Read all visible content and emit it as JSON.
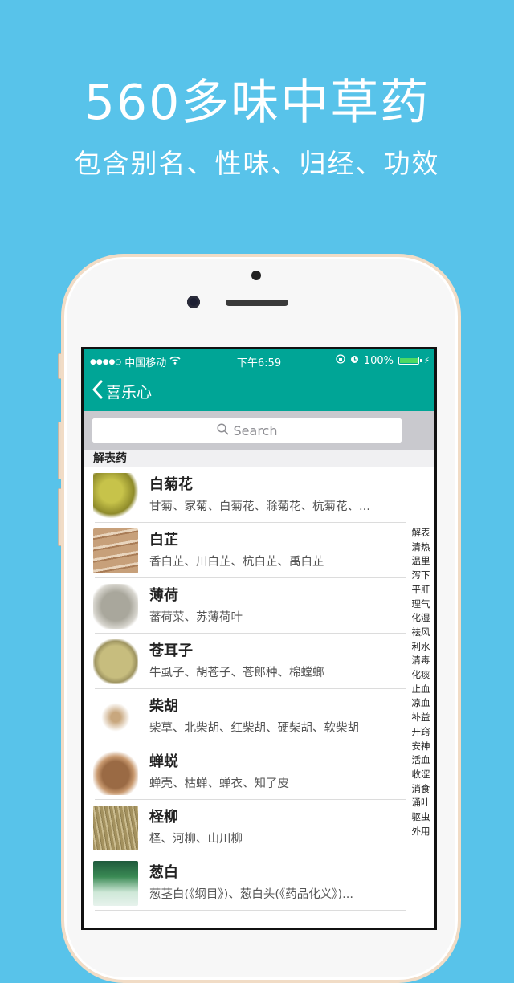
{
  "promo": {
    "headline": "560多味中草药",
    "subline": "包含别名、性味、归经、功效"
  },
  "statusbar": {
    "signal": "●●●●○",
    "carrier": "中国移动",
    "wifi_icon": "wifi-icon",
    "time": "下午6:59",
    "battery_percent": "100%",
    "battery_level": 1.0
  },
  "navbar": {
    "back_label": "喜乐心"
  },
  "search": {
    "placeholder": "Search"
  },
  "section": {
    "title": "解表药"
  },
  "items": [
    {
      "name": "白菊花",
      "alias": "甘菊、家菊、白菊花、滁菊花、杭菊花、..."
    },
    {
      "name": "白芷",
      "alias": "香白芷、川白芷、杭白芷、禹白芷"
    },
    {
      "name": "薄荷",
      "alias": "蕃荷菜、苏薄荷叶"
    },
    {
      "name": "苍耳子",
      "alias": "牛虱子、胡苍子、苍郎种、棉螳螂"
    },
    {
      "name": "柴胡",
      "alias": "柴草、北柴胡、红柴胡、硬柴胡、软柴胡"
    },
    {
      "name": "蝉蜕",
      "alias": "蝉壳、枯蝉、蝉衣、知了皮"
    },
    {
      "name": "柽柳",
      "alias": "柽、河柳、山川柳"
    },
    {
      "name": "葱白",
      "alias": "葱茎白(《纲目》)、葱白头(《药品化义》)..."
    }
  ],
  "index": [
    "解表",
    "清热",
    "温里",
    "泻下",
    "平肝",
    "理气",
    "化湿",
    "祛风",
    "利水",
    "清毒",
    "化痰",
    "止血",
    "凉血",
    "补益",
    "开窍",
    "安神",
    "活血",
    "收涩",
    "消食",
    "涌吐",
    "驱虫",
    "外用"
  ]
}
